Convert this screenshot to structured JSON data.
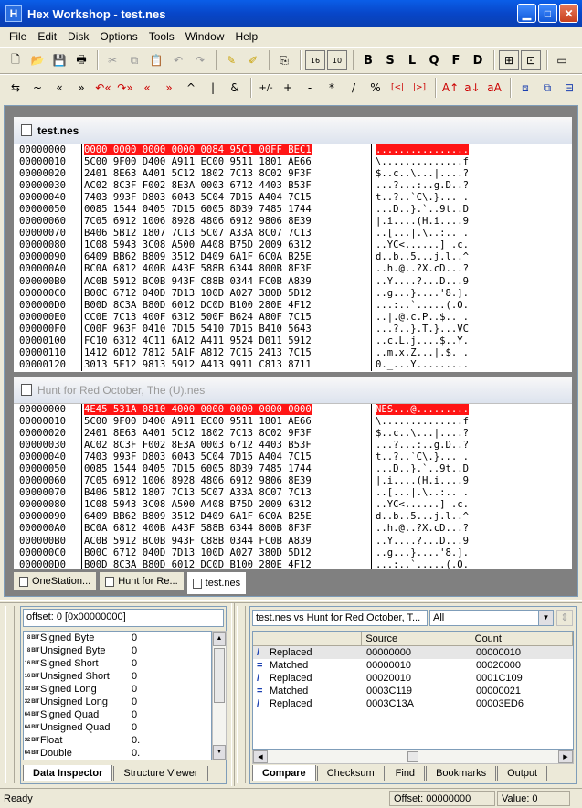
{
  "window": {
    "title": "Hex Workshop - test.nes",
    "app_icon": "H"
  },
  "menu": [
    "File",
    "Edit",
    "Disk",
    "Options",
    "Tools",
    "Window",
    "Help"
  ],
  "toolbar1": [
    "new-file-icon",
    "open-file-icon",
    "save-icon",
    "print-icon",
    "|",
    "cut-icon",
    "copy-icon",
    "paste-icon",
    "undo-icon",
    "redo-icon",
    "|",
    "highlight-icon",
    "clear-highlight-icon",
    "|",
    "copy-clipboard-icon",
    "|",
    "16-bit-icon",
    "10-base-icon",
    "|",
    "B",
    "S",
    "L",
    "Q",
    "F",
    "D",
    "|",
    "data-inspector-icon",
    "structure-icon",
    "|",
    "window-icon"
  ],
  "toolbar1_labels": {
    "b": "B",
    "s": "S",
    "l": "L",
    "q": "Q",
    "f": "F",
    "d": "D",
    "hex16": "16",
    "dec10": "10"
  },
  "toolbar2": {
    "items": [
      "⇆",
      "~",
      "«",
      "»",
      "↶«",
      "↷»",
      "«",
      "»",
      "^",
      "|",
      "&",
      "+/-",
      "+",
      "-",
      "*",
      "/",
      "%",
      "[<|",
      "|>]",
      "A↑",
      "a↓",
      "aA"
    ]
  },
  "documents": [
    {
      "title": "test.nes",
      "active": true,
      "selection": {
        "row": 0,
        "hex": "0000 0000 0000 0000 0084 95C1 00FF BEC1",
        "ascii": "................"
      },
      "rows": [
        {
          "off": "00000000",
          "hex": "0000 0000 0000 0000 0084 95C1 00FF BEC1",
          "asc": "................"
        },
        {
          "off": "00000010",
          "hex": "5C00 9F00 D400 A911 EC00 9511 1801 AE66",
          "asc": "\\..............f"
        },
        {
          "off": "00000020",
          "hex": "2401 8E63 A401 5C12 1802 7C13 8C02 9F3F",
          "asc": "$..c..\\...|....?"
        },
        {
          "off": "00000030",
          "hex": "AC02 8C3F F002 8E3A 0003 6712 4403 B53F",
          "asc": "...?...:..g.D..?"
        },
        {
          "off": "00000040",
          "hex": "7403 993F D803 6043 5C04 7D15 A404 7C15",
          "asc": "t..?..`C\\.}...|."
        },
        {
          "off": "00000050",
          "hex": "0085 1544 0405 7D15 6005 8D39 7485 1744",
          "asc": "...D..}.`..9t..D"
        },
        {
          "off": "00000060",
          "hex": "7C05 6912 1006 8928 4806 6912 9806 8E39",
          "asc": "|.i....(H.i....9"
        },
        {
          "off": "00000070",
          "hex": "B406 5B12 1807 7C13 5C07 A33A 8C07 7C13",
          "asc": "..[...|.\\..:..|."
        },
        {
          "off": "00000080",
          "hex": "1C08 5943 3C08 A500 A408 B75D 2009 6312",
          "asc": "..YC<......] .c."
        },
        {
          "off": "00000090",
          "hex": "6409 BB62 B809 3512 D409 6A1F 6C0A B25E",
          "asc": "d..b..5...j.l..^"
        },
        {
          "off": "000000A0",
          "hex": "BC0A 6812 400B A43F 588B 6344 800B 8F3F",
          "asc": "..h.@..?X.cD...?"
        },
        {
          "off": "000000B0",
          "hex": "AC0B 5912 BC0B 943F C88B 0344 FC0B A839",
          "asc": "..Y....?...D...9"
        },
        {
          "off": "000000C0",
          "hex": "B00C 6712 040D 7D13 100D A027 380D 5D12",
          "asc": "..g...}....'8.]."
        },
        {
          "off": "000000D0",
          "hex": "B00D 8C3A B80D 6012 DC0D B100 280E 4F12",
          "asc": "...:..`.....(.O."
        },
        {
          "off": "000000E0",
          "hex": "CC0E 7C13 400F 6312 500F B624 A80F 7C15",
          "asc": "..|.@.c.P..$..|."
        },
        {
          "off": "000000F0",
          "hex": "C00F 963F 0410 7D15 5410 7D15 B410 5643",
          "asc": "...?..}.T.}...VC"
        },
        {
          "off": "00000100",
          "hex": "FC10 6312 4C11 6A12 A411 9524 D011 5912",
          "asc": "..c.L.j....$..Y."
        },
        {
          "off": "00000110",
          "hex": "1412 6D12 7812 5A1F A812 7C15 2413 7C15",
          "asc": "..m.x.Z...|.$.|."
        },
        {
          "off": "00000120",
          "hex": "3013 5F12 9813 5912 A413 9911 C813 8711",
          "asc": "0._...Y........."
        }
      ]
    },
    {
      "title": "Hunt for Red October, The (U).nes",
      "active": false,
      "rows": [
        {
          "off": "00000000",
          "hex": "4E45 531A 0810 4000 0000 0000 0000 0000",
          "asc": "NES...@........."
        },
        {
          "off": "00000010",
          "hex": "5C00 9F00 D400 A911 EC00 9511 1801 AE66",
          "asc": "\\..............f"
        },
        {
          "off": "00000020",
          "hex": "2401 8E63 A401 5C12 1802 7C13 8C02 9F3F",
          "asc": "$..c..\\...|....?"
        },
        {
          "off": "00000030",
          "hex": "AC02 8C3F F002 8E3A 0003 6712 4403 B53F",
          "asc": "...?...:..g.D..?"
        },
        {
          "off": "00000040",
          "hex": "7403 993F D803 6043 5C04 7D15 A404 7C15",
          "asc": "t..?..`C\\.}...|."
        },
        {
          "off": "00000050",
          "hex": "0085 1544 0405 7D15 6005 8D39 7485 1744",
          "asc": "...D..}.`..9t..D"
        },
        {
          "off": "00000060",
          "hex": "7C05 6912 1006 8928 4806 6912 9806 8E39",
          "asc": "|.i....(H.i....9"
        },
        {
          "off": "00000070",
          "hex": "B406 5B12 1807 7C13 5C07 A33A 8C07 7C13",
          "asc": "..[...|.\\..:..|."
        },
        {
          "off": "00000080",
          "hex": "1C08 5943 3C08 A500 A408 B75D 2009 6312",
          "asc": "..YC<......] .c."
        },
        {
          "off": "00000090",
          "hex": "6409 BB62 B809 3512 D409 6A1F 6C0A B25E",
          "asc": "d..b..5...j.l..^"
        },
        {
          "off": "000000A0",
          "hex": "BC0A 6812 400B A43F 588B 6344 800B 8F3F",
          "asc": "..h.@..?X.cD...?"
        },
        {
          "off": "000000B0",
          "hex": "AC0B 5912 BC0B 943F C88B 0344 FC0B A839",
          "asc": "..Y....?...D...9"
        },
        {
          "off": "000000C0",
          "hex": "B00C 6712 040D 7D13 100D A027 380D 5D12",
          "asc": "..g...}....'8.]."
        },
        {
          "off": "000000D0",
          "hex": "B00D 8C3A B80D 6012 DC0D B100 280E 4F12",
          "asc": "...:..`.....(.O."
        }
      ]
    }
  ],
  "mdi_tabs": [
    {
      "label": "OneStation...",
      "active": false
    },
    {
      "label": "Hunt for Re...",
      "active": false
    },
    {
      "label": "test.nes",
      "active": true
    }
  ],
  "data_inspector": {
    "offset_label": "offset: 0 [0x00000000]",
    "rows": [
      {
        "badge": "8 BIT",
        "label": "Signed Byte",
        "value": "0"
      },
      {
        "badge": "8 BIT",
        "label": "Unsigned Byte",
        "value": "0"
      },
      {
        "badge": "16 BIT",
        "label": "Signed Short",
        "value": "0"
      },
      {
        "badge": "16 BIT",
        "label": "Unsigned Short",
        "value": "0"
      },
      {
        "badge": "32 BIT",
        "label": "Signed Long",
        "value": "0"
      },
      {
        "badge": "32 BIT",
        "label": "Unsigned Long",
        "value": "0"
      },
      {
        "badge": "64 BIT",
        "label": "Signed Quad",
        "value": "0"
      },
      {
        "badge": "64 BIT",
        "label": "Unsigned Quad",
        "value": "0"
      },
      {
        "badge": "32 BIT",
        "label": "Float",
        "value": "0."
      },
      {
        "badge": "64 BIT",
        "label": "Double",
        "value": "0."
      }
    ],
    "tabs": [
      "Data Inspector",
      "Structure Viewer"
    ]
  },
  "compare": {
    "title": "test.nes vs Hunt for Red October, T...",
    "filter": "All",
    "columns": [
      "",
      "Source",
      "Count"
    ],
    "rows": [
      {
        "type": "Replaced",
        "icon": "replaced-icon",
        "source": "00000000",
        "count": "00000010"
      },
      {
        "type": "Matched",
        "icon": "matched-icon",
        "source": "00000010",
        "count": "00020000"
      },
      {
        "type": "Replaced",
        "icon": "replaced-icon",
        "source": "00020010",
        "count": "0001C109"
      },
      {
        "type": "Matched",
        "icon": "matched-icon",
        "source": "0003C119",
        "count": "00000021"
      },
      {
        "type": "Replaced",
        "icon": "replaced-icon",
        "source": "0003C13A",
        "count": "00003ED6"
      }
    ],
    "tabs": [
      "Compare",
      "Checksum",
      "Find",
      "Bookmarks",
      "Output"
    ]
  },
  "status": {
    "ready": "Ready",
    "offset": "Offset: 00000000",
    "value": "Value: 0"
  },
  "colors": {
    "selection": "#ff1515",
    "titlebar": "#0846c8"
  }
}
